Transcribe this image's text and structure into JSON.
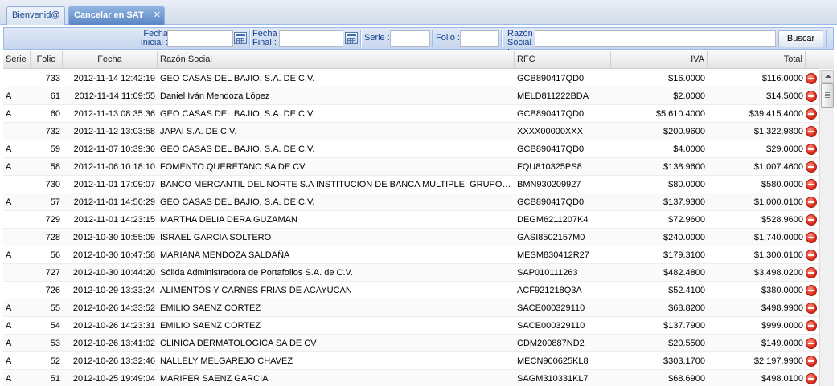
{
  "tabs": [
    {
      "label": "Bienvenid@"
    },
    {
      "label": "Cancelar en SAT",
      "close": "✕"
    }
  ],
  "toolbar": {
    "fecha_inicial_label": "Fecha\nInicial :",
    "fecha_final_label": "Fecha\nFinal :",
    "serie_label": "Serie :",
    "folio_label": "Folio :",
    "razon_social_label": "Razón\nSocial :",
    "fecha_inicial_value": "",
    "fecha_final_value": "",
    "serie_value": "",
    "folio_value": "",
    "razon_social_value": "",
    "search_label": "Buscar"
  },
  "columns": {
    "serie": "Serie",
    "folio": "Folio",
    "fecha": "Fecha",
    "razon": "Razón Social",
    "rfc": "RFC",
    "iva": "IVA",
    "total": "Total"
  },
  "rows": [
    {
      "serie": "",
      "folio": "733",
      "fecha": "2012-11-14 12:42:19",
      "razon": "GEO CASAS DEL BAJIO, S.A. DE C.V.",
      "rfc": "GCB890417QD0",
      "iva": "$16.0000",
      "total": "$116.0000"
    },
    {
      "serie": "A",
      "folio": "61",
      "fecha": "2012-11-14 11:09:55",
      "razon": "Daniel Iván Mendoza López",
      "rfc": "MELD811222BDA",
      "iva": "$2.0000",
      "total": "$14.5000"
    },
    {
      "serie": "A",
      "folio": "60",
      "fecha": "2012-11-13 08:35:36",
      "razon": "GEO CASAS DEL BAJIO, S.A. DE C.V.",
      "rfc": "GCB890417QD0",
      "iva": "$5,610.4000",
      "total": "$39,415.4000"
    },
    {
      "serie": "",
      "folio": "732",
      "fecha": "2012-11-12 13:03:58",
      "razon": "JAPAI S.A. DE C.V.",
      "rfc": "XXXX00000XXX",
      "iva": "$200.9600",
      "total": "$1,322.9800"
    },
    {
      "serie": "A",
      "folio": "59",
      "fecha": "2012-11-07 10:39:36",
      "razon": "GEO CASAS DEL BAJIO, S.A. DE C.V.",
      "rfc": "GCB890417QD0",
      "iva": "$4.0000",
      "total": "$29.0000"
    },
    {
      "serie": "A",
      "folio": "58",
      "fecha": "2012-11-06 10:18:10",
      "razon": "FOMENTO QUERETANO SA DE CV",
      "rfc": "FQU810325PS8",
      "iva": "$138.9600",
      "total": "$1,007.4600"
    },
    {
      "serie": "",
      "folio": "730",
      "fecha": "2012-11-01 17:09:07",
      "razon": "BANCO MERCANTIL DEL NORTE S.A INSTITUCION DE BANCA MULTIPLE, GRUPO FINANCIERO BANORTE",
      "rfc": "BMN930209927",
      "iva": "$80.0000",
      "total": "$580.0000"
    },
    {
      "serie": "A",
      "folio": "57",
      "fecha": "2012-11-01 14:56:29",
      "razon": "GEO CASAS DEL BAJIO, S.A. DE C.V.",
      "rfc": "GCB890417QD0",
      "iva": "$137.9300",
      "total": "$1,000.0100"
    },
    {
      "serie": "",
      "folio": "729",
      "fecha": "2012-11-01 14:23:15",
      "razon": "MARTHA DELIA DERA GUZAMAN",
      "rfc": "DEGM6211207K4",
      "iva": "$72.9600",
      "total": "$528.9600"
    },
    {
      "serie": "",
      "folio": "728",
      "fecha": "2012-10-30 10:55:09",
      "razon": "ISRAEL GARCIA SOLTERO",
      "rfc": "GASI8502157M0",
      "iva": "$240.0000",
      "total": "$1,740.0000"
    },
    {
      "serie": "A",
      "folio": "56",
      "fecha": "2012-10-30 10:47:58",
      "razon": "MARIANA MENDOZA SALDAÑA",
      "rfc": "MESM830412R27",
      "iva": "$179.3100",
      "total": "$1,300.0100"
    },
    {
      "serie": "",
      "folio": "727",
      "fecha": "2012-10-30 10:44:20",
      "razon": "Sólida Administradora de Portafolios S.A. de C.V.",
      "rfc": "SAP010111263",
      "iva": "$482.4800",
      "total": "$3,498.0200"
    },
    {
      "serie": "",
      "folio": "726",
      "fecha": "2012-10-29 13:33:24",
      "razon": "ALIMENTOS Y CARNES FRIAS DE ACAYUCAN",
      "rfc": "ACF921218Q3A",
      "iva": "$52.4100",
      "total": "$380.0000"
    },
    {
      "serie": "A",
      "folio": "55",
      "fecha": "2012-10-26 14:33:52",
      "razon": "EMILIO SAENZ CORTEZ",
      "rfc": "SACE000329110",
      "iva": "$68.8200",
      "total": "$498.9900"
    },
    {
      "serie": "A",
      "folio": "54",
      "fecha": "2012-10-26 14:23:31",
      "razon": "EMILIO SAENZ CORTEZ",
      "rfc": "SACE000329110",
      "iva": "$137.7900",
      "total": "$999.0000"
    },
    {
      "serie": "A",
      "folio": "53",
      "fecha": "2012-10-26 13:41:02",
      "razon": "CLINICA DERMATOLOGICA SA DE CV",
      "rfc": "CDM200887ND2",
      "iva": "$20.5500",
      "total": "$149.0000"
    },
    {
      "serie": "A",
      "folio": "52",
      "fecha": "2012-10-26 13:32:46",
      "razon": "NALLELY MELGAREJO CHAVEZ",
      "rfc": "MECN900625KL8",
      "iva": "$303.1700",
      "total": "$2,197.9900"
    },
    {
      "serie": "A",
      "folio": "51",
      "fecha": "2012-10-25 19:49:04",
      "razon": "MARIFER SAENZ GARCIA",
      "rfc": "SAGM310331KL7",
      "iva": "$68.6900",
      "total": "$498.0100"
    }
  ]
}
